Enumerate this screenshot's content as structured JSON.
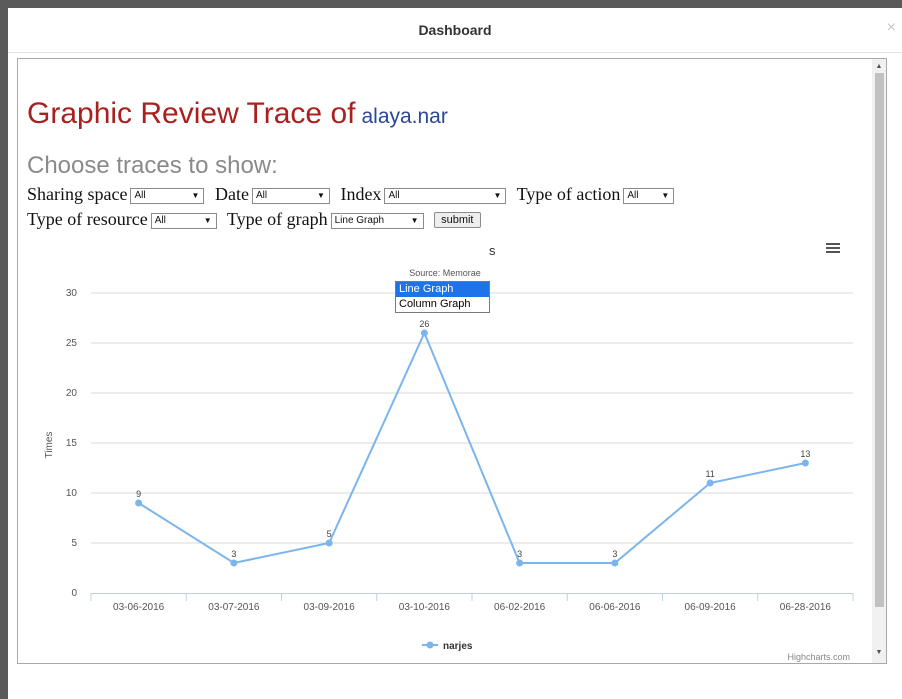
{
  "modal": {
    "title": "Dashboard",
    "close_glyph": "×"
  },
  "page": {
    "heading": "Graphic Review Trace of",
    "user": "alaya.nar",
    "subtitle": "Choose traces to show:"
  },
  "filters": {
    "sharing_space": {
      "label": "Sharing space",
      "value": "All"
    },
    "date": {
      "label": "Date",
      "value": "All"
    },
    "index": {
      "label": "Index",
      "value": "All"
    },
    "action_type": {
      "label": "Type of action",
      "value": "All"
    },
    "resource_type": {
      "label": "Type of resource",
      "value": "All"
    },
    "graph_type": {
      "label": "Type of graph",
      "value": "Line Graph",
      "options": [
        "Line Graph",
        "Column Graph"
      ]
    },
    "submit_label": "submit"
  },
  "chart_title_fragment": "s",
  "chart_data": {
    "type": "line",
    "subtitle": "Source: Memorae",
    "ylabel": "Times",
    "ylim": [
      0,
      30
    ],
    "yticks": [
      0,
      5,
      10,
      15,
      20,
      25,
      30
    ],
    "categories": [
      "03-06-2016",
      "03-07-2016",
      "03-09-2016",
      "03-10-2016",
      "06-02-2016",
      "06-06-2016",
      "06-09-2016",
      "06-28-2016"
    ],
    "series": [
      {
        "name": "narjes",
        "values": [
          9,
          3,
          5,
          26,
          3,
          3,
          11,
          13
        ],
        "color": "#7cb5ec"
      }
    ],
    "data_labels": true,
    "grid": true,
    "legend": "bottom-center",
    "credits": "Highcharts.com"
  },
  "icons": {
    "menu": "hamburger-menu-icon",
    "scroll_up": "▲",
    "scroll_down": "▼",
    "caret": "▼"
  }
}
